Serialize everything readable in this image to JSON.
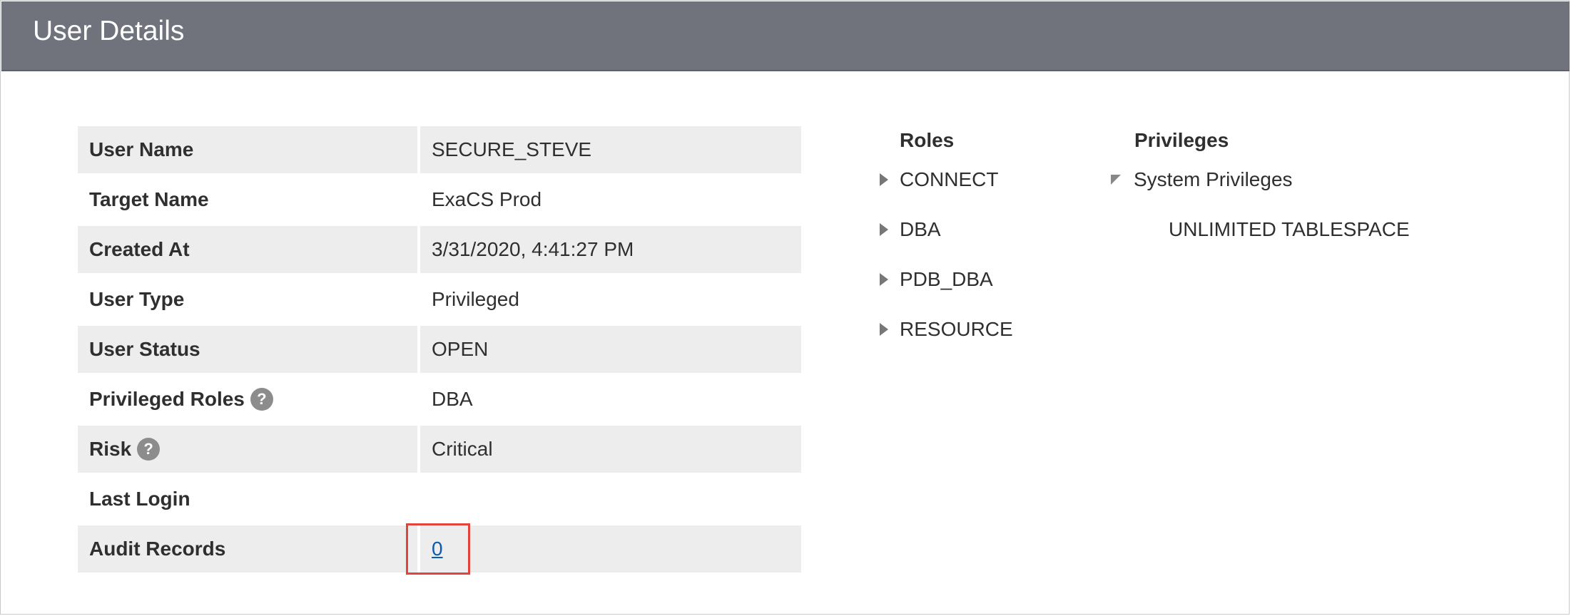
{
  "header": {
    "title": "User Details"
  },
  "details": {
    "rows": [
      {
        "label": "User Name",
        "value": "SECURE_STEVE"
      },
      {
        "label": "Target Name",
        "value": "ExaCS Prod"
      },
      {
        "label": "Created At",
        "value": "3/31/2020, 4:41:27 PM"
      },
      {
        "label": "User Type",
        "value": "Privileged"
      },
      {
        "label": "User Status",
        "value": "OPEN"
      },
      {
        "label": "Privileged Roles",
        "value": "DBA",
        "help_icon": "?"
      },
      {
        "label": "Risk",
        "value": "Critical",
        "help_icon": "?"
      },
      {
        "label": "Last Login",
        "value": ""
      },
      {
        "label": "Audit Records",
        "value": "0"
      }
    ]
  },
  "roles": {
    "heading": "Roles",
    "items": [
      "CONNECT",
      "DBA",
      "PDB_DBA",
      "RESOURCE"
    ]
  },
  "privileges": {
    "heading": "Privileges",
    "group": "System Privileges",
    "children": [
      "UNLIMITED TABLESPACE"
    ]
  },
  "colors": {
    "header_bg": "#70737c",
    "row_shade": "#ededed",
    "link": "#0b5cad",
    "highlight": "#e0443a"
  }
}
